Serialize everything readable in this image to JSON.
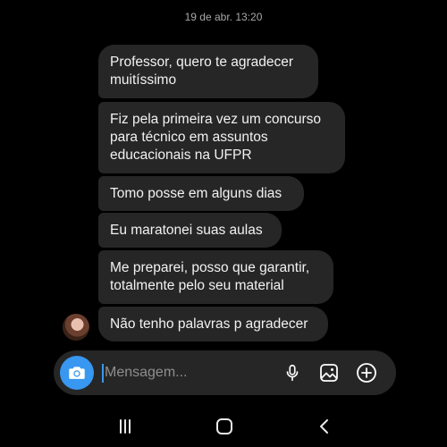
{
  "conversation": {
    "timestamp": "19 de abr. 13:20",
    "messages": [
      {
        "text": "Professor, quero te agradecer\nmuitíssimo"
      },
      {
        "text": "Fiz pela primeira vez um concurso\npara técnico em assuntos\neducacionais na UFPR"
      },
      {
        "text": "Tomo posse em alguns dias"
      },
      {
        "text": "Eu maratonei suas aulas"
      },
      {
        "text": "Me preparei, posso que garantir,\ntotalmente pelo seu material"
      },
      {
        "text": "Não tenho palavras p agradecer"
      }
    ]
  },
  "composer": {
    "placeholder": "Mensagem...",
    "camera_icon": "camera-icon",
    "mic_icon": "microphone-icon",
    "gallery_icon": "image-icon",
    "add_icon": "plus-circle-icon",
    "accent": "#3897f0"
  },
  "navigation": {
    "recent_icon": "recent-apps-icon",
    "home_icon": "home-icon",
    "back_icon": "back-icon"
  }
}
